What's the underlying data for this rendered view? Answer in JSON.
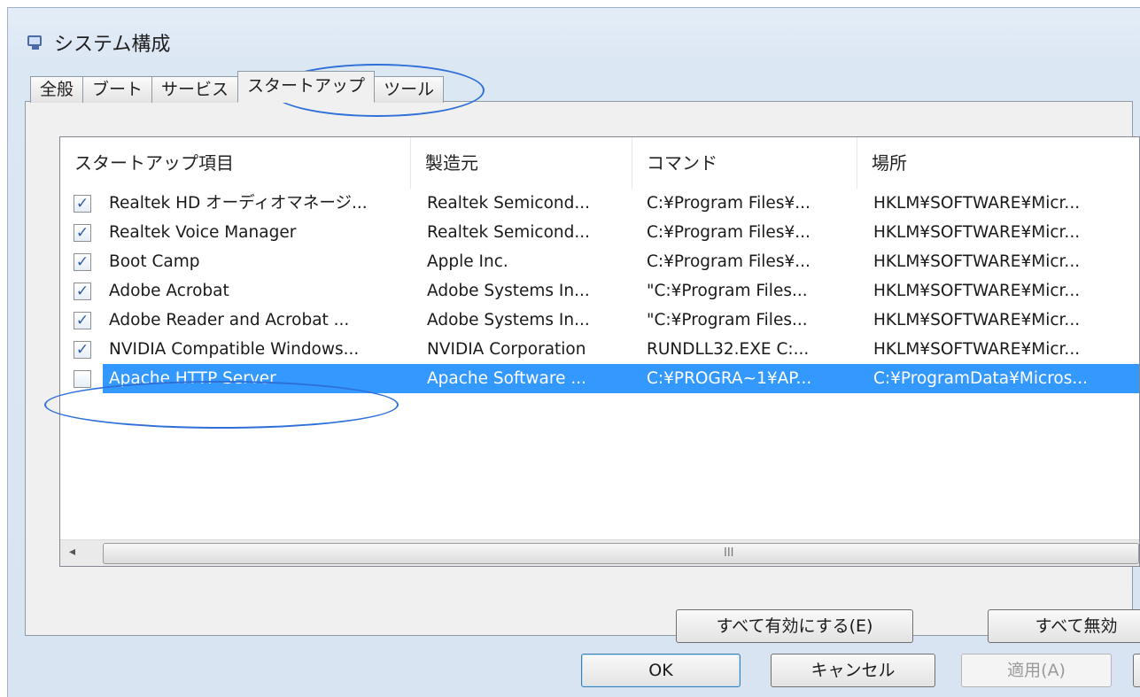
{
  "window": {
    "title": "システム構成"
  },
  "tabs": [
    {
      "label": "全般"
    },
    {
      "label": "ブート"
    },
    {
      "label": "サービス"
    },
    {
      "label": "スタートアップ"
    },
    {
      "label": "ツール"
    }
  ],
  "active_tab": "スタートアップ",
  "list": {
    "columns": [
      "スタートアップ項目",
      "製造元",
      "コマンド",
      "場所"
    ],
    "rows": [
      {
        "checked": true,
        "item": "Realtek HD オーディオマネージ...",
        "maker": "Realtek Semicond...",
        "command": "C:¥Program Files¥...",
        "location": "HKLM¥SOFTWARE¥Micr..."
      },
      {
        "checked": true,
        "item": "Realtek Voice  Manager",
        "maker": "Realtek Semicond...",
        "command": "C:¥Program Files¥...",
        "location": "HKLM¥SOFTWARE¥Micr..."
      },
      {
        "checked": true,
        "item": "Boot Camp",
        "maker": "Apple Inc.",
        "command": "C:¥Program Files¥...",
        "location": "HKLM¥SOFTWARE¥Micr..."
      },
      {
        "checked": true,
        "item": "Adobe Acrobat",
        "maker": "Adobe Systems In...",
        "command": "\"C:¥Program Files...",
        "location": "HKLM¥SOFTWARE¥Micr..."
      },
      {
        "checked": true,
        "item": "Adobe Reader and Acrobat ...",
        "maker": "Adobe Systems In...",
        "command": "\"C:¥Program Files...",
        "location": "HKLM¥SOFTWARE¥Micr..."
      },
      {
        "checked": true,
        "item": "NVIDIA Compatible Windows...",
        "maker": "NVIDIA Corporation",
        "command": "RUNDLL32.EXE C:...",
        "location": "HKLM¥SOFTWARE¥Micr..."
      },
      {
        "checked": false,
        "item": "Apache HTTP Server",
        "maker": "Apache Software ...",
        "command": "C:¥PROGRA~1¥AP...",
        "location": "C:¥ProgramData¥Micros..."
      }
    ],
    "selected_row": 6
  },
  "scrollbar": {
    "left_arrow": "◂",
    "grip": "III"
  },
  "buttons": {
    "enable_all": "すべて有効にする(E)",
    "disable_all": "すべて無効",
    "ok": "OK",
    "cancel": "キャンセル",
    "apply": "適用(A)"
  },
  "colors": {
    "selection": "#3399ff",
    "annotation": "#2e6fd8",
    "checkmark": "#2f5aa8"
  }
}
